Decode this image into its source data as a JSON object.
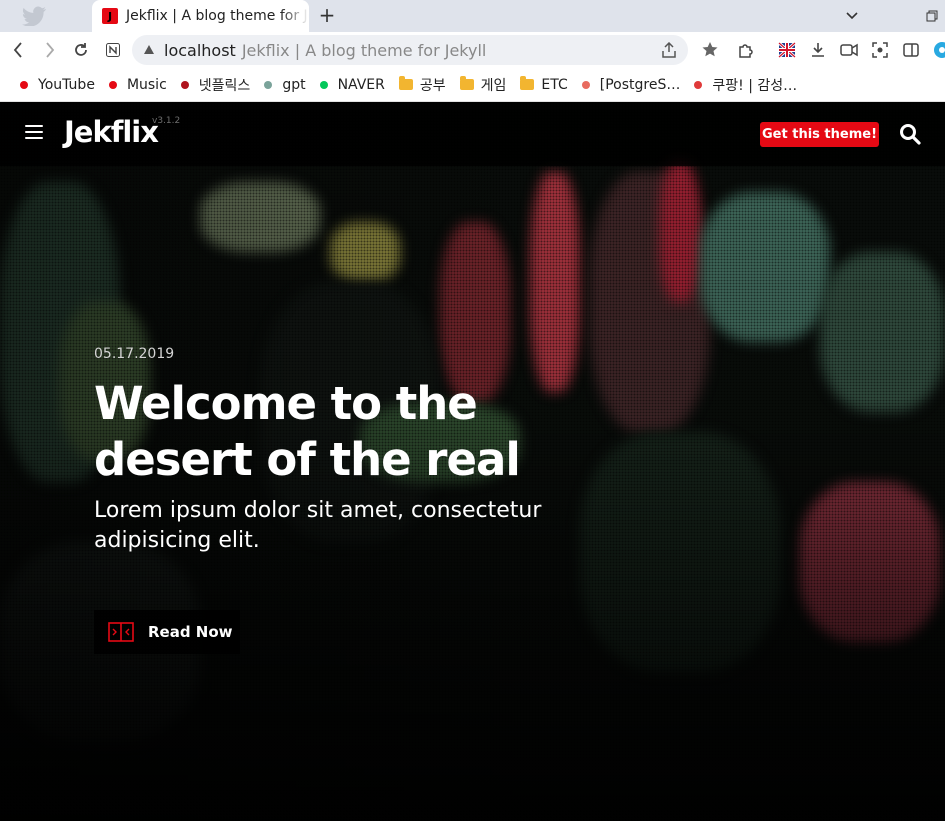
{
  "browser": {
    "tab_title": "Jekflix | A blog theme for Jekyll",
    "favicon_letter": "J",
    "url_host": "localhost",
    "url_title": "Jekflix | A blog theme for Jekyll"
  },
  "bookmarks": [
    {
      "label": "YouTube",
      "kind": "dot",
      "color": "#e50914"
    },
    {
      "label": "Music",
      "kind": "dot",
      "color": "#e50914"
    },
    {
      "label": "넷플릭스",
      "kind": "dot",
      "color": "#b0141d"
    },
    {
      "label": "gpt",
      "kind": "dot",
      "color": "#7aa39a"
    },
    {
      "label": "NAVER",
      "kind": "dot",
      "color": "#03c75a"
    },
    {
      "label": "공부",
      "kind": "folder"
    },
    {
      "label": "게임",
      "kind": "folder"
    },
    {
      "label": "ETC",
      "kind": "folder"
    },
    {
      "label": "[PostgreS…",
      "kind": "dot",
      "color": "#e86b5f"
    },
    {
      "label": "쿠팡! | 감성…",
      "kind": "dot",
      "color": "#e03a3a"
    }
  ],
  "site": {
    "logo": "Jekflix",
    "version": "v3.1.2",
    "cta_label": "Get this theme!",
    "accent_color": "#e50914"
  },
  "hero": {
    "date": "05.17.2019",
    "title": "Welcome to the desert of the real",
    "subtitle": "Lorem ipsum dolor sit amet, consectetur adipisicing elit.",
    "button_label": "Read Now"
  }
}
